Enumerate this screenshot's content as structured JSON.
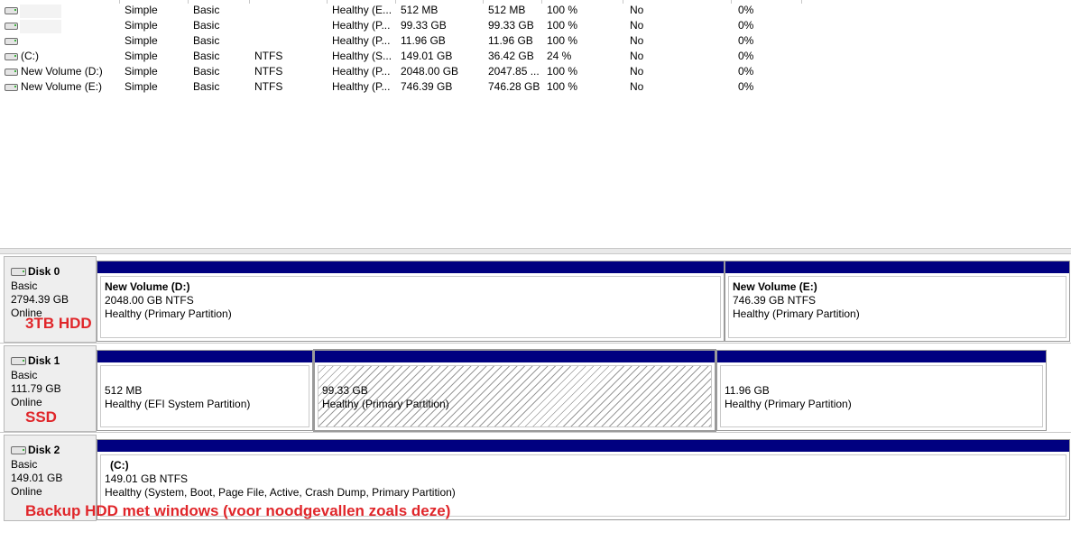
{
  "volumes": [
    {
      "name": "",
      "layout": "Simple",
      "type": "Basic",
      "fs": "",
      "status": "Healthy (E...",
      "capacity": "512 MB",
      "free": "512 MB",
      "pct": "100 %",
      "ft": "No",
      "overhead": "0%"
    },
    {
      "name": "",
      "layout": "Simple",
      "type": "Basic",
      "fs": "",
      "status": "Healthy (P...",
      "capacity": "99.33 GB",
      "free": "99.33 GB",
      "pct": "100 %",
      "ft": "No",
      "overhead": "0%"
    },
    {
      "name": "",
      "layout": "Simple",
      "type": "Basic",
      "fs": "",
      "status": "Healthy (P...",
      "capacity": "11.96 GB",
      "free": "11.96 GB",
      "pct": "100 %",
      "ft": "No",
      "overhead": "0%"
    },
    {
      "name": "(C:)",
      "layout": "Simple",
      "type": "Basic",
      "fs": "NTFS",
      "status": "Healthy (S...",
      "capacity": "149.01 GB",
      "free": "36.42 GB",
      "pct": "24 %",
      "ft": "No",
      "overhead": "0%"
    },
    {
      "name": "New Volume (D:)",
      "layout": "Simple",
      "type": "Basic",
      "fs": "NTFS",
      "status": "Healthy (P...",
      "capacity": "2048.00 GB",
      "free": "2047.85 ...",
      "pct": "100 %",
      "ft": "No",
      "overhead": "0%"
    },
    {
      "name": "New Volume (E:)",
      "layout": "Simple",
      "type": "Basic",
      "fs": "NTFS",
      "status": "Healthy (P...",
      "capacity": "746.39 GB",
      "free": "746.28 GB",
      "pct": "100 %",
      "ft": "No",
      "overhead": "0%"
    }
  ],
  "disks": [
    {
      "name": "Disk 0",
      "type": "Basic",
      "size": "2794.39 GB",
      "state": "Online",
      "annotation": "3TB HDD",
      "partitions": [
        {
          "title": "New Volume  (D:)",
          "size": "2048.00 GB NTFS",
          "status": "Healthy (Primary Partition)"
        },
        {
          "title": "New Volume  (E:)",
          "size": "746.39 GB NTFS",
          "status": "Healthy (Primary Partition)"
        }
      ]
    },
    {
      "name": "Disk 1",
      "type": "Basic",
      "size": "111.79 GB",
      "state": "Online",
      "annotation": "SSD",
      "partitions": [
        {
          "title": "",
          "size": "512 MB",
          "status": "Healthy (EFI System Partition)"
        },
        {
          "title": "",
          "size": "99.33 GB",
          "status": "Healthy (Primary Partition)"
        },
        {
          "title": "",
          "size": "11.96 GB",
          "status": "Healthy (Primary Partition)"
        }
      ]
    },
    {
      "name": "Disk 2",
      "type": "Basic",
      "size": "149.01 GB",
      "state": "Online",
      "annotation": "Backup HDD met windows (voor noodgevallen zoals deze)",
      "partitions": [
        {
          "title": "(C:)",
          "size": "149.01 GB NTFS",
          "status": "Healthy (System, Boot, Page File, Active, Crash Dump, Primary Partition)"
        }
      ]
    }
  ],
  "colors": {
    "partition_bar": "#000080",
    "annotation": "#e0262a"
  },
  "icons": {
    "volume": "drive-icon",
    "disk": "disk-icon"
  }
}
